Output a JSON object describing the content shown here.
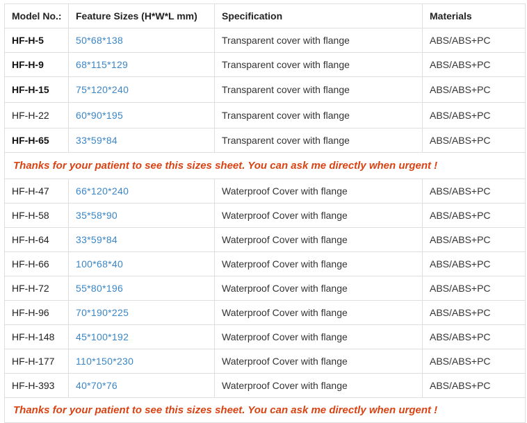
{
  "header": {
    "model": "Model No.:",
    "size": "Feature Sizes (H*W*L mm)",
    "spec": "Specification",
    "materials": "Materials"
  },
  "group1": [
    {
      "model": "HF-H-5",
      "size": "50*68*138",
      "spec": "Transparent cover with flange",
      "materials": "ABS/ABS+PC"
    },
    {
      "model": "HF-H-9",
      "size": "68*115*129",
      "spec": "Transparent cover with flange",
      "materials": "ABS/ABS+PC"
    },
    {
      "model": "HF-H-15",
      "size": "75*120*240",
      "spec": "Transparent cover with flange",
      "materials": "ABS/ABS+PC"
    },
    {
      "model": "HF-H-22",
      "size": "60*90*195",
      "spec": "Transparent cover with flange",
      "materials": "ABS/ABS+PC"
    },
    {
      "model": "HF-H-65",
      "size": "33*59*84",
      "spec": "Transparent cover with flange",
      "materials": "ABS/ABS+PC"
    }
  ],
  "notice1": "Thanks for your patient to see this sizes sheet. You can ask me directly when urgent !",
  "group2": [
    {
      "model": "HF-H-47",
      "size": "66*120*240",
      "spec": "Waterproof Cover with flange",
      "materials": "ABS/ABS+PC"
    },
    {
      "model": "HF-H-58",
      "size": "35*58*90",
      "spec": "Waterproof Cover with flange",
      "materials": "ABS/ABS+PC"
    },
    {
      "model": "HF-H-64",
      "size": "33*59*84",
      "spec": "Waterproof Cover with flange",
      "materials": "ABS/ABS+PC"
    },
    {
      "model": "HF-H-66",
      "size": "100*68*40",
      "spec": "Waterproof Cover with flange",
      "materials": "ABS/ABS+PC"
    },
    {
      "model": "HF-H-72",
      "size": "55*80*196",
      "spec": "Waterproof Cover with flange",
      "materials": "ABS/ABS+PC"
    },
    {
      "model": "HF-H-96",
      "size": "70*190*225",
      "spec": "Waterproof Cover with flange",
      "materials": "ABS/ABS+PC"
    },
    {
      "model": "HF-H-148",
      "size": "45*100*192",
      "spec": "Waterproof Cover with flange",
      "materials": "ABS/ABS+PC"
    },
    {
      "model": "HF-H-177",
      "size": "110*150*230",
      "spec": "Waterproof Cover with flange",
      "materials": "ABS/ABS+PC"
    },
    {
      "model": "HF-H-393",
      "size": "40*70*76",
      "spec": "Waterproof Cover with flange",
      "materials": "ABS/ABS+PC"
    }
  ],
  "notice2": "Thanks for your patient to see this sizes sheet. You can ask me directly when urgent !",
  "colors": {
    "notice": "#d84313",
    "size_link": "#3a86c6",
    "border": "#dedede"
  }
}
